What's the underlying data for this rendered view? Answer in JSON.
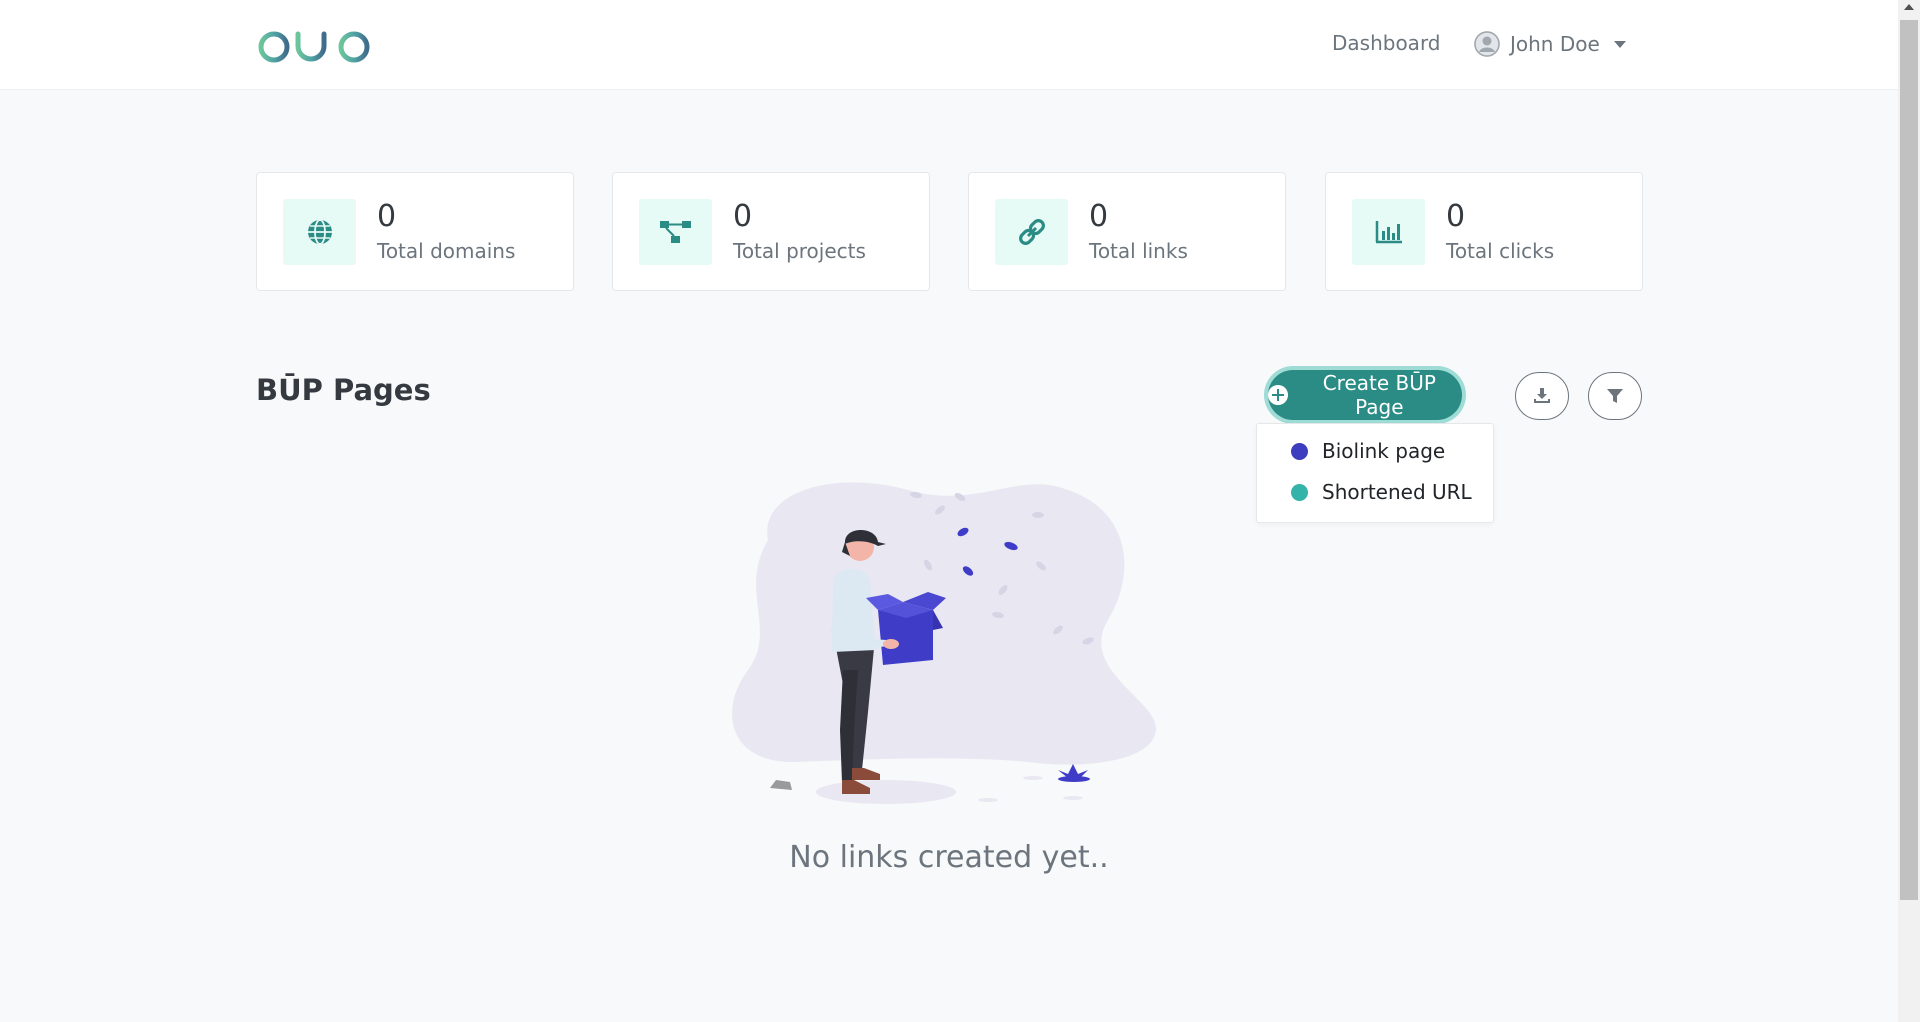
{
  "header": {
    "brand": "būp",
    "nav_dashboard": "Dashboard",
    "user_name": "John Doe"
  },
  "stats": [
    {
      "value": "0",
      "label": "Total domains",
      "icon": "globe-icon"
    },
    {
      "value": "0",
      "label": "Total projects",
      "icon": "sitemap-icon"
    },
    {
      "value": "0",
      "label": "Total links",
      "icon": "link-icon"
    },
    {
      "value": "0",
      "label": "Total clicks",
      "icon": "bar-chart-icon"
    }
  ],
  "section": {
    "title": "BŪP Pages",
    "create_button": "Create BŪP Page",
    "dropdown": [
      {
        "label": "Biolink page",
        "color": "#3d3dbf"
      },
      {
        "label": "Shortened URL",
        "color": "#34b3aa"
      }
    ]
  },
  "empty_state": {
    "message": "No links created yet.."
  },
  "colors": {
    "accent": "#2a8c85",
    "accent_light": "#e6faf6",
    "illustration_primary": "#3f3dc8"
  }
}
